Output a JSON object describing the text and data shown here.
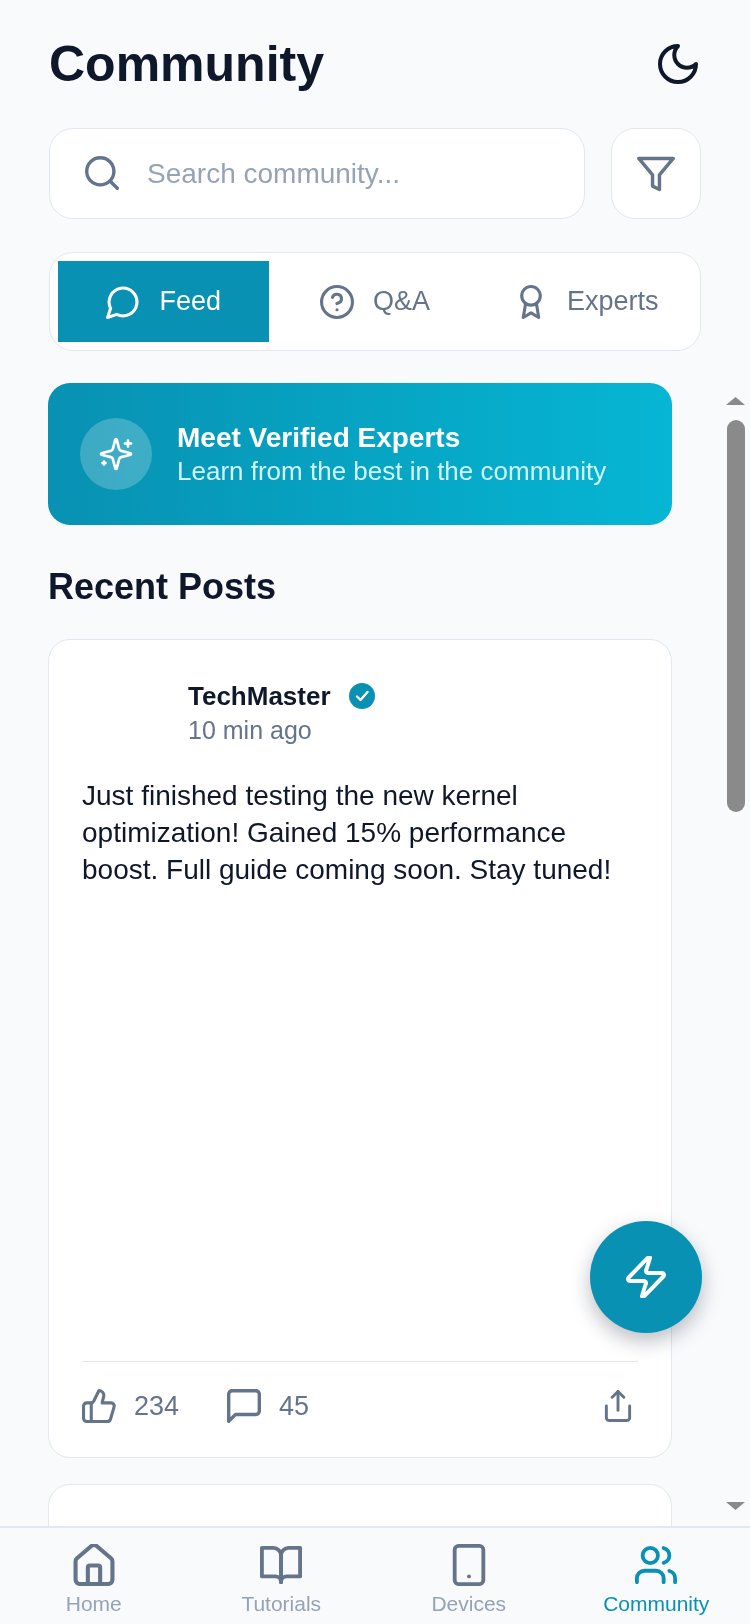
{
  "header": {
    "title": "Community"
  },
  "search": {
    "placeholder": "Search community..."
  },
  "tabs": [
    {
      "label": "Feed",
      "selected": true
    },
    {
      "label": "Q&A",
      "selected": false
    },
    {
      "label": "Experts",
      "selected": false
    }
  ],
  "banner": {
    "title": "Meet Verified Experts",
    "subtitle": "Learn from the best in the community"
  },
  "section_title": "Recent Posts",
  "posts": [
    {
      "author": "TechMaster",
      "verified": true,
      "time": "10 min ago",
      "body": "Just finished testing the new kernel optimization! Gained 15% performance boost. Full guide coming soon. Stay tuned!",
      "likes": "234",
      "comments": "45"
    }
  ],
  "nav": [
    {
      "label": "Home",
      "selected": false
    },
    {
      "label": "Tutorials",
      "selected": false
    },
    {
      "label": "Devices",
      "selected": false
    },
    {
      "label": "Community",
      "selected": true
    }
  ]
}
